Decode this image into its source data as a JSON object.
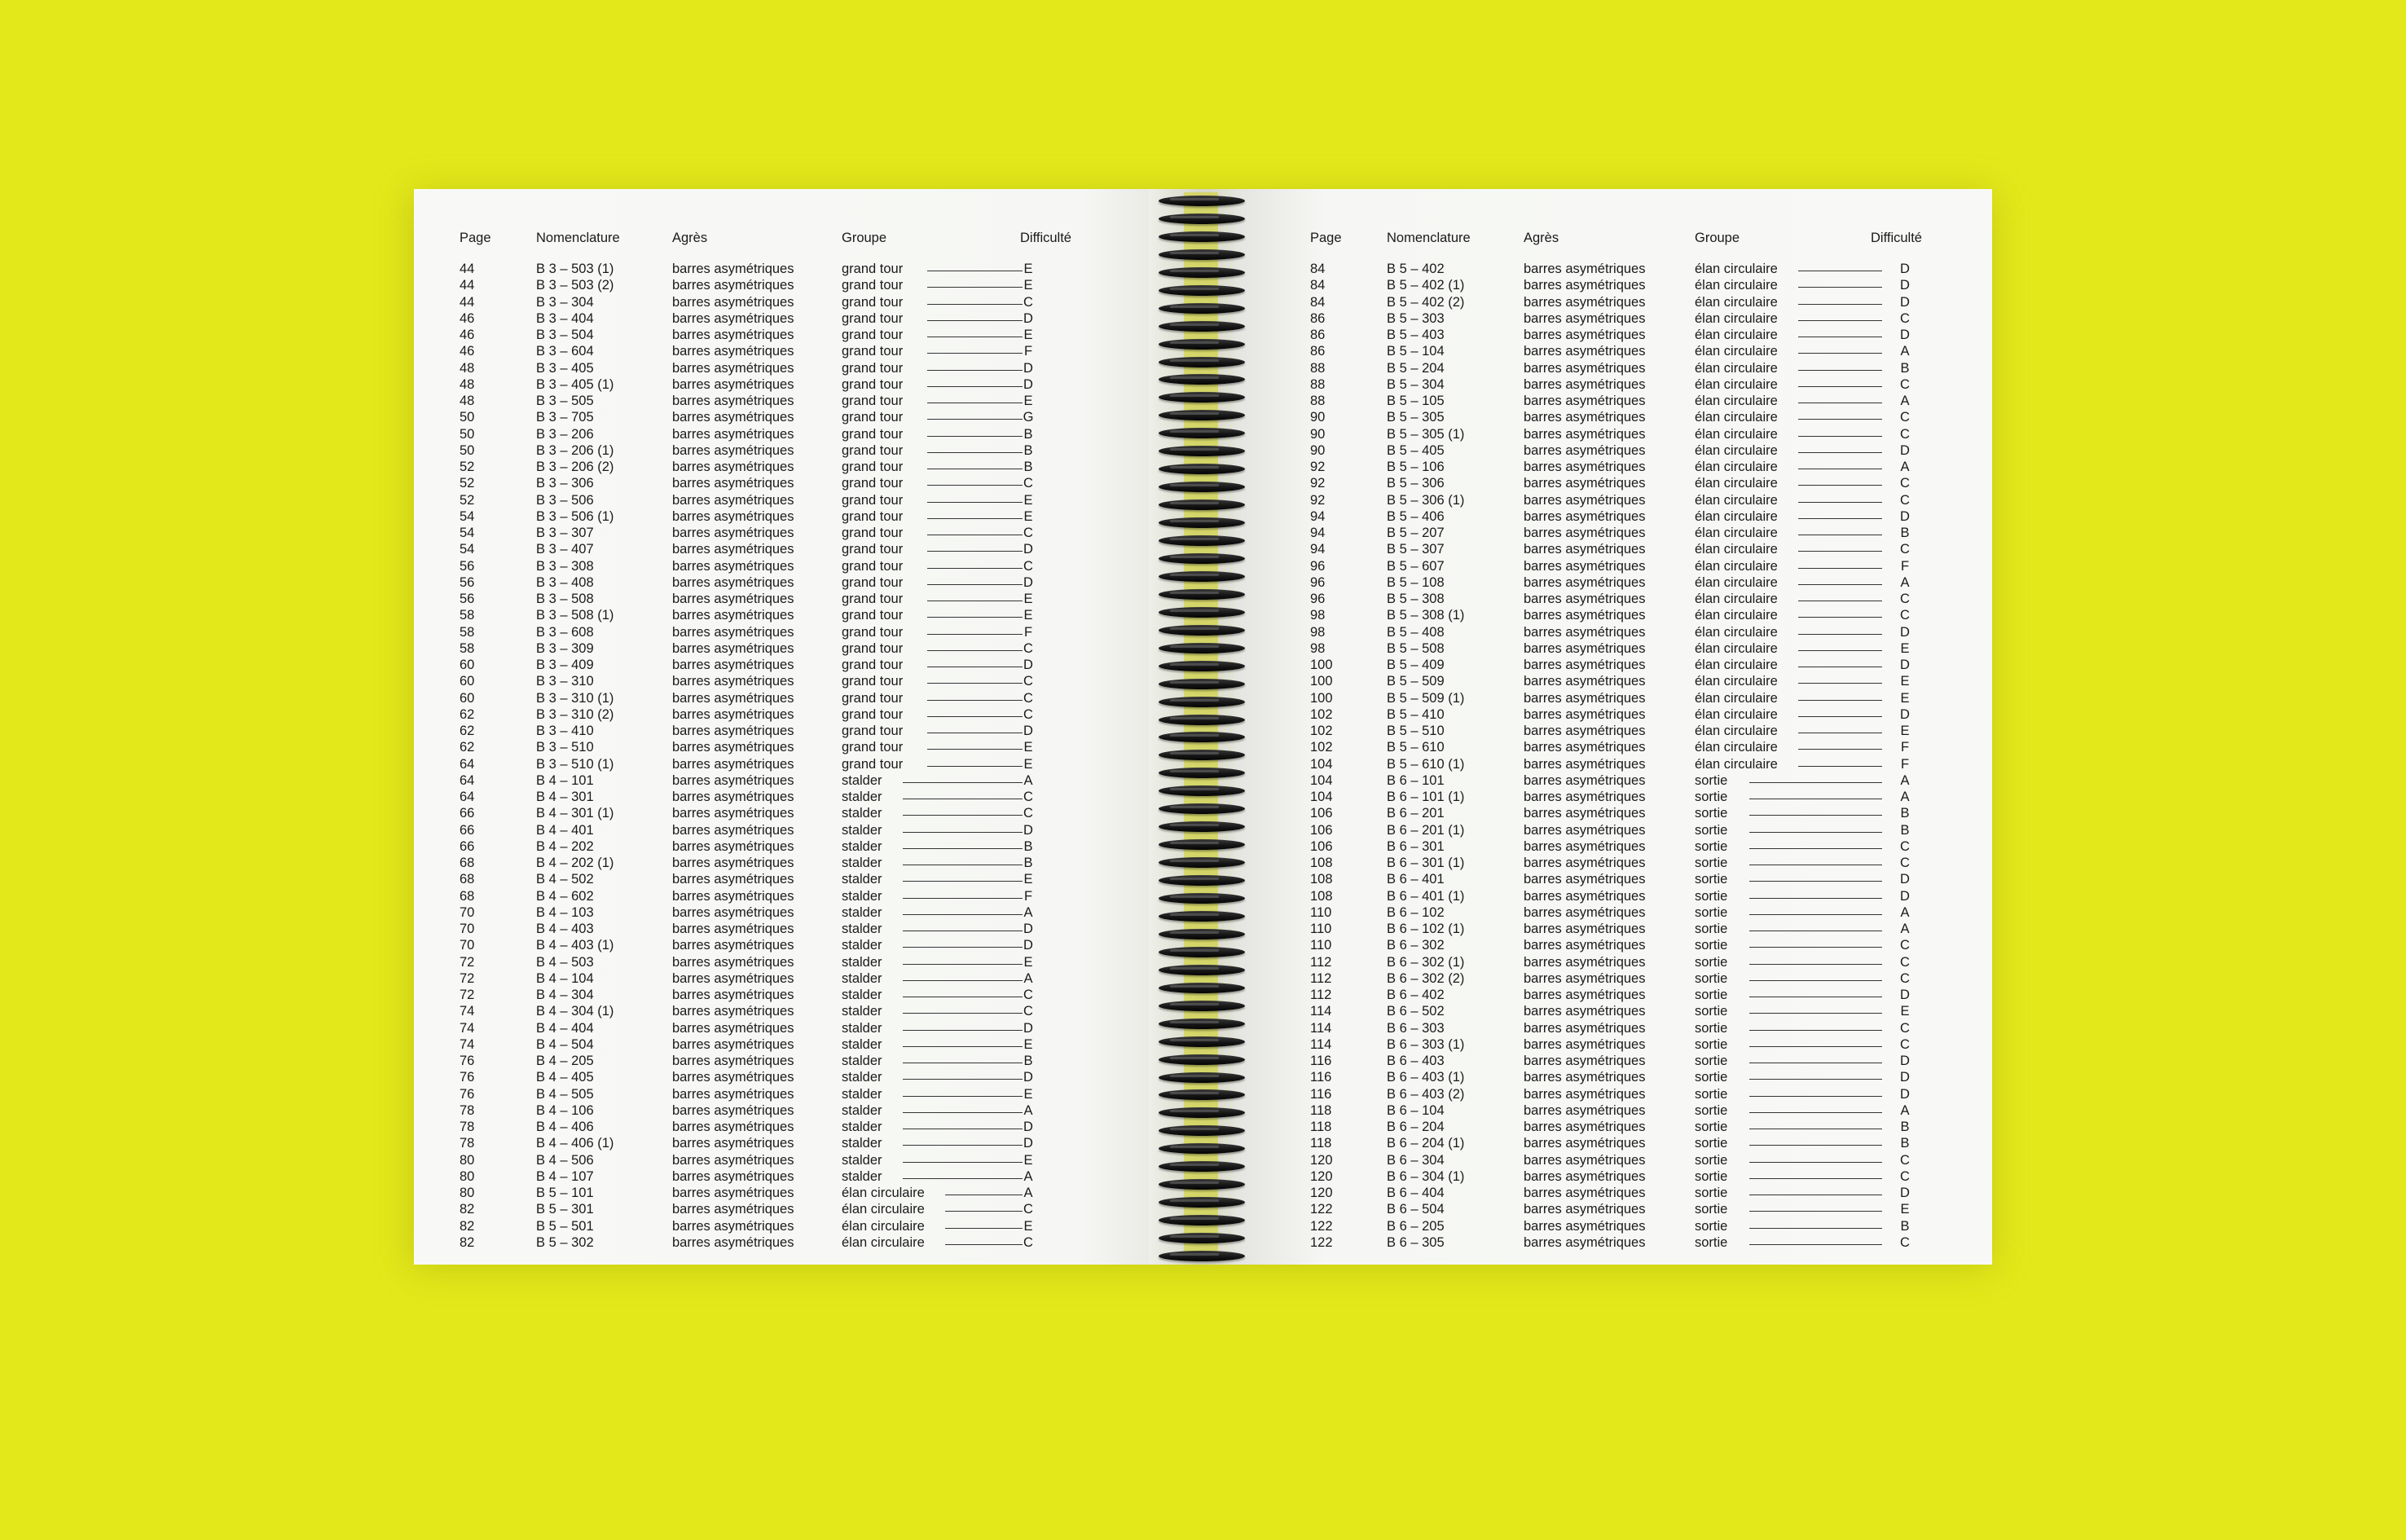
{
  "headers": {
    "page": "Page",
    "nomenclature": "Nomenclature",
    "agres": "Agrès",
    "groupe": "Groupe",
    "difficulte": "Difficulté"
  },
  "left_rows": [
    [
      "44",
      "B 3 – 503 (1)",
      "barres asymétriques",
      "grand tour",
      "E"
    ],
    [
      "44",
      "B 3 – 503 (2)",
      "barres asymétriques",
      "grand tour",
      "E"
    ],
    [
      "44",
      "B 3 – 304",
      "barres asymétriques",
      "grand tour",
      "C"
    ],
    [
      "46",
      "B 3 – 404",
      "barres asymétriques",
      "grand tour",
      "D"
    ],
    [
      "46",
      "B 3 – 504",
      "barres asymétriques",
      "grand tour",
      "E"
    ],
    [
      "46",
      "B 3 – 604",
      "barres asymétriques",
      "grand tour",
      "F"
    ],
    [
      "48",
      "B 3 – 405",
      "barres asymétriques",
      "grand tour",
      "D"
    ],
    [
      "48",
      "B 3 – 405 (1)",
      "barres asymétriques",
      "grand tour",
      "D"
    ],
    [
      "48",
      "B 3 – 505",
      "barres asymétriques",
      "grand tour",
      "E"
    ],
    [
      "50",
      "B 3 – 705",
      "barres asymétriques",
      "grand tour",
      "G"
    ],
    [
      "50",
      "B 3 – 206",
      "barres asymétriques",
      "grand tour",
      "B"
    ],
    [
      "50",
      "B 3 – 206 (1)",
      "barres asymétriques",
      "grand tour",
      "B"
    ],
    [
      "52",
      "B 3 – 206 (2)",
      "barres asymétriques",
      "grand tour",
      "B"
    ],
    [
      "52",
      "B 3 – 306",
      "barres asymétriques",
      "grand tour",
      "C"
    ],
    [
      "52",
      "B 3 – 506",
      "barres asymétriques",
      "grand tour",
      "E"
    ],
    [
      "54",
      "B 3 – 506 (1)",
      "barres asymétriques",
      "grand tour",
      "E"
    ],
    [
      "54",
      "B 3 – 307",
      "barres asymétriques",
      "grand tour",
      "C"
    ],
    [
      "54",
      "B 3 – 407",
      "barres asymétriques",
      "grand tour",
      "D"
    ],
    [
      "56",
      "B 3 – 308",
      "barres asymétriques",
      "grand tour",
      "C"
    ],
    [
      "56",
      "B 3 – 408",
      "barres asymétriques",
      "grand tour",
      "D"
    ],
    [
      "56",
      "B 3 – 508",
      "barres asymétriques",
      "grand tour",
      "E"
    ],
    [
      "58",
      "B 3 – 508 (1)",
      "barres asymétriques",
      "grand tour",
      "E"
    ],
    [
      "58",
      "B 3 – 608",
      "barres asymétriques",
      "grand tour",
      "F"
    ],
    [
      "58",
      "B 3 – 309",
      "barres asymétriques",
      "grand tour",
      "C"
    ],
    [
      "60",
      "B 3 – 409",
      "barres asymétriques",
      "grand tour",
      "D"
    ],
    [
      "60",
      "B 3 – 310",
      "barres asymétriques",
      "grand tour",
      "C"
    ],
    [
      "60",
      "B 3 – 310 (1)",
      "barres asymétriques",
      "grand tour",
      "C"
    ],
    [
      "62",
      "B 3 – 310 (2)",
      "barres asymétriques",
      "grand tour",
      "C"
    ],
    [
      "62",
      "B 3 – 410",
      "barres asymétriques",
      "grand tour",
      "D"
    ],
    [
      "62",
      "B 3 – 510",
      "barres asymétriques",
      "grand tour",
      "E"
    ],
    [
      "64",
      "B 3 – 510 (1)",
      "barres asymétriques",
      "grand tour",
      "E"
    ],
    [
      "64",
      "B 4 – 101",
      "barres asymétriques",
      "stalder",
      "A"
    ],
    [
      "64",
      "B 4 – 301",
      "barres asymétriques",
      "stalder",
      "C"
    ],
    [
      "66",
      "B 4 – 301 (1)",
      "barres asymétriques",
      "stalder",
      "C"
    ],
    [
      "66",
      "B 4 – 401",
      "barres asymétriques",
      "stalder",
      "D"
    ],
    [
      "66",
      "B 4 – 202",
      "barres asymétriques",
      "stalder",
      "B"
    ],
    [
      "68",
      "B 4 – 202 (1)",
      "barres asymétriques",
      "stalder",
      "B"
    ],
    [
      "68",
      "B 4 – 502",
      "barres asymétriques",
      "stalder",
      "E"
    ],
    [
      "68",
      "B 4 – 602",
      "barres asymétriques",
      "stalder",
      "F"
    ],
    [
      "70",
      "B 4 – 103",
      "barres asymétriques",
      "stalder",
      "A"
    ],
    [
      "70",
      "B 4 – 403",
      "barres asymétriques",
      "stalder",
      "D"
    ],
    [
      "70",
      "B 4 – 403 (1)",
      "barres asymétriques",
      "stalder",
      "D"
    ],
    [
      "72",
      "B 4 – 503",
      "barres asymétriques",
      "stalder",
      "E"
    ],
    [
      "72",
      "B 4 – 104",
      "barres asymétriques",
      "stalder",
      "A"
    ],
    [
      "72",
      "B 4 – 304",
      "barres asymétriques",
      "stalder",
      "C"
    ],
    [
      "74",
      "B 4 – 304 (1)",
      "barres asymétriques",
      "stalder",
      "C"
    ],
    [
      "74",
      "B 4 – 404",
      "barres asymétriques",
      "stalder",
      "D"
    ],
    [
      "74",
      "B 4 – 504",
      "barres asymétriques",
      "stalder",
      "E"
    ],
    [
      "76",
      "B 4 – 205",
      "barres asymétriques",
      "stalder",
      "B"
    ],
    [
      "76",
      "B 4 – 405",
      "barres asymétriques",
      "stalder",
      "D"
    ],
    [
      "76",
      "B 4 – 505",
      "barres asymétriques",
      "stalder",
      "E"
    ],
    [
      "78",
      "B 4 – 106",
      "barres asymétriques",
      "stalder",
      "A"
    ],
    [
      "78",
      "B 4 – 406",
      "barres asymétriques",
      "stalder",
      "D"
    ],
    [
      "78",
      "B 4 – 406 (1)",
      "barres asymétriques",
      "stalder",
      "D"
    ],
    [
      "80",
      "B 4 – 506",
      "barres asymétriques",
      "stalder",
      "E"
    ],
    [
      "80",
      "B 4 – 107",
      "barres asymétriques",
      "stalder",
      "A"
    ],
    [
      "80",
      "B 5 – 101",
      "barres asymétriques",
      "élan circulaire",
      "A"
    ],
    [
      "82",
      "B 5 – 301",
      "barres asymétriques",
      "élan circulaire",
      "C"
    ],
    [
      "82",
      "B 5 – 501",
      "barres asymétriques",
      "élan circulaire",
      "E"
    ],
    [
      "82",
      "B 5 – 302",
      "barres asymétriques",
      "élan circulaire",
      "C"
    ]
  ],
  "right_rows": [
    [
      "84",
      "B 5 – 402",
      "barres asymétriques",
      "élan circulaire",
      "D"
    ],
    [
      "84",
      "B 5 – 402 (1)",
      "barres asymétriques",
      "élan circulaire",
      "D"
    ],
    [
      "84",
      "B 5 – 402 (2)",
      "barres asymétriques",
      "élan circulaire",
      "D"
    ],
    [
      "86",
      "B 5 – 303",
      "barres asymétriques",
      "élan circulaire",
      "C"
    ],
    [
      "86",
      "B 5 – 403",
      "barres asymétriques",
      "élan circulaire",
      "D"
    ],
    [
      "86",
      "B 5 – 104",
      "barres asymétriques",
      "élan circulaire",
      "A"
    ],
    [
      "88",
      "B 5 – 204",
      "barres asymétriques",
      "élan circulaire",
      "B"
    ],
    [
      "88",
      "B 5 – 304",
      "barres asymétriques",
      "élan circulaire",
      "C"
    ],
    [
      "88",
      "B 5 – 105",
      "barres asymétriques",
      "élan circulaire",
      "A"
    ],
    [
      "90",
      "B 5 – 305",
      "barres asymétriques",
      "élan circulaire",
      "C"
    ],
    [
      "90",
      "B 5 – 305 (1)",
      "barres asymétriques",
      "élan circulaire",
      "C"
    ],
    [
      "90",
      "B 5 – 405",
      "barres asymétriques",
      "élan circulaire",
      "D"
    ],
    [
      "92",
      "B 5 – 106",
      "barres asymétriques",
      "élan circulaire",
      "A"
    ],
    [
      "92",
      "B 5 – 306",
      "barres asymétriques",
      "élan circulaire",
      "C"
    ],
    [
      "92",
      "B 5 – 306 (1)",
      "barres asymétriques",
      "élan circulaire",
      "C"
    ],
    [
      "94",
      "B 5 – 406",
      "barres asymétriques",
      "élan circulaire",
      "D"
    ],
    [
      "94",
      "B 5 – 207",
      "barres asymétriques",
      "élan circulaire",
      "B"
    ],
    [
      "94",
      "B 5 – 307",
      "barres asymétriques",
      "élan circulaire",
      "C"
    ],
    [
      "96",
      "B 5 – 607",
      "barres asymétriques",
      "élan circulaire",
      "F"
    ],
    [
      "96",
      "B 5 – 108",
      "barres asymétriques",
      "élan circulaire",
      "A"
    ],
    [
      "96",
      "B 5 – 308",
      "barres asymétriques",
      "élan circulaire",
      "C"
    ],
    [
      "98",
      "B 5 – 308 (1)",
      "barres asymétriques",
      "élan circulaire",
      "C"
    ],
    [
      "98",
      "B 5 – 408",
      "barres asymétriques",
      "élan circulaire",
      "D"
    ],
    [
      "98",
      "B 5 – 508",
      "barres asymétriques",
      "élan circulaire",
      "E"
    ],
    [
      "100",
      "B 5 – 409",
      "barres asymétriques",
      "élan circulaire",
      "D"
    ],
    [
      "100",
      "B 5 – 509",
      "barres asymétriques",
      "élan circulaire",
      "E"
    ],
    [
      "100",
      "B 5 – 509 (1)",
      "barres asymétriques",
      "élan circulaire",
      "E"
    ],
    [
      "102",
      "B 5 – 410",
      "barres asymétriques",
      "élan circulaire",
      "D"
    ],
    [
      "102",
      "B 5 – 510",
      "barres asymétriques",
      "élan circulaire",
      "E"
    ],
    [
      "102",
      "B 5 – 610",
      "barres asymétriques",
      "élan circulaire",
      "F"
    ],
    [
      "104",
      "B 5 – 610 (1)",
      "barres asymétriques",
      "élan circulaire",
      "F"
    ],
    [
      "104",
      "B 6 – 101",
      "barres asymétriques",
      "sortie",
      "A"
    ],
    [
      "104",
      "B 6 – 101 (1)",
      "barres asymétriques",
      "sortie",
      "A"
    ],
    [
      "106",
      "B 6 – 201",
      "barres asymétriques",
      "sortie",
      "B"
    ],
    [
      "106",
      "B 6 – 201 (1)",
      "barres asymétriques",
      "sortie",
      "B"
    ],
    [
      "106",
      "B 6 – 301",
      "barres asymétriques",
      "sortie",
      "C"
    ],
    [
      "108",
      "B 6 – 301 (1)",
      "barres asymétriques",
      "sortie",
      "C"
    ],
    [
      "108",
      "B 6 – 401",
      "barres asymétriques",
      "sortie",
      "D"
    ],
    [
      "108",
      "B 6 – 401 (1)",
      "barres asymétriques",
      "sortie",
      "D"
    ],
    [
      "110",
      "B 6 – 102",
      "barres asymétriques",
      "sortie",
      "A"
    ],
    [
      "110",
      "B 6 – 102 (1)",
      "barres asymétriques",
      "sortie",
      "A"
    ],
    [
      "110",
      "B 6 – 302",
      "barres asymétriques",
      "sortie",
      "C"
    ],
    [
      "112",
      "B 6 – 302 (1)",
      "barres asymétriques",
      "sortie",
      "C"
    ],
    [
      "112",
      "B 6 – 302 (2)",
      "barres asymétriques",
      "sortie",
      "C"
    ],
    [
      "112",
      "B 6 – 402",
      "barres asymétriques",
      "sortie",
      "D"
    ],
    [
      "114",
      "B 6 – 502",
      "barres asymétriques",
      "sortie",
      "E"
    ],
    [
      "114",
      "B 6 – 303",
      "barres asymétriques",
      "sortie",
      "C"
    ],
    [
      "114",
      "B 6 – 303 (1)",
      "barres asymétriques",
      "sortie",
      "C"
    ],
    [
      "116",
      "B 6 – 403",
      "barres asymétriques",
      "sortie",
      "D"
    ],
    [
      "116",
      "B 6 – 403 (1)",
      "barres asymétriques",
      "sortie",
      "D"
    ],
    [
      "116",
      "B 6 – 403 (2)",
      "barres asymétriques",
      "sortie",
      "D"
    ],
    [
      "118",
      "B 6 – 104",
      "barres asymétriques",
      "sortie",
      "A"
    ],
    [
      "118",
      "B 6 – 204",
      "barres asymétriques",
      "sortie",
      "B"
    ],
    [
      "118",
      "B 6 – 204 (1)",
      "barres asymétriques",
      "sortie",
      "B"
    ],
    [
      "120",
      "B 6 – 304",
      "barres asymétriques",
      "sortie",
      "C"
    ],
    [
      "120",
      "B 6 – 304 (1)",
      "barres asymétriques",
      "sortie",
      "C"
    ],
    [
      "120",
      "B 6 – 404",
      "barres asymétriques",
      "sortie",
      "D"
    ],
    [
      "122",
      "B 6 – 504",
      "barres asymétriques",
      "sortie",
      "E"
    ],
    [
      "122",
      "B 6 – 205",
      "barres asymétriques",
      "sortie",
      "B"
    ],
    [
      "122",
      "B 6 – 305",
      "barres asymétriques",
      "sortie",
      "C"
    ]
  ]
}
